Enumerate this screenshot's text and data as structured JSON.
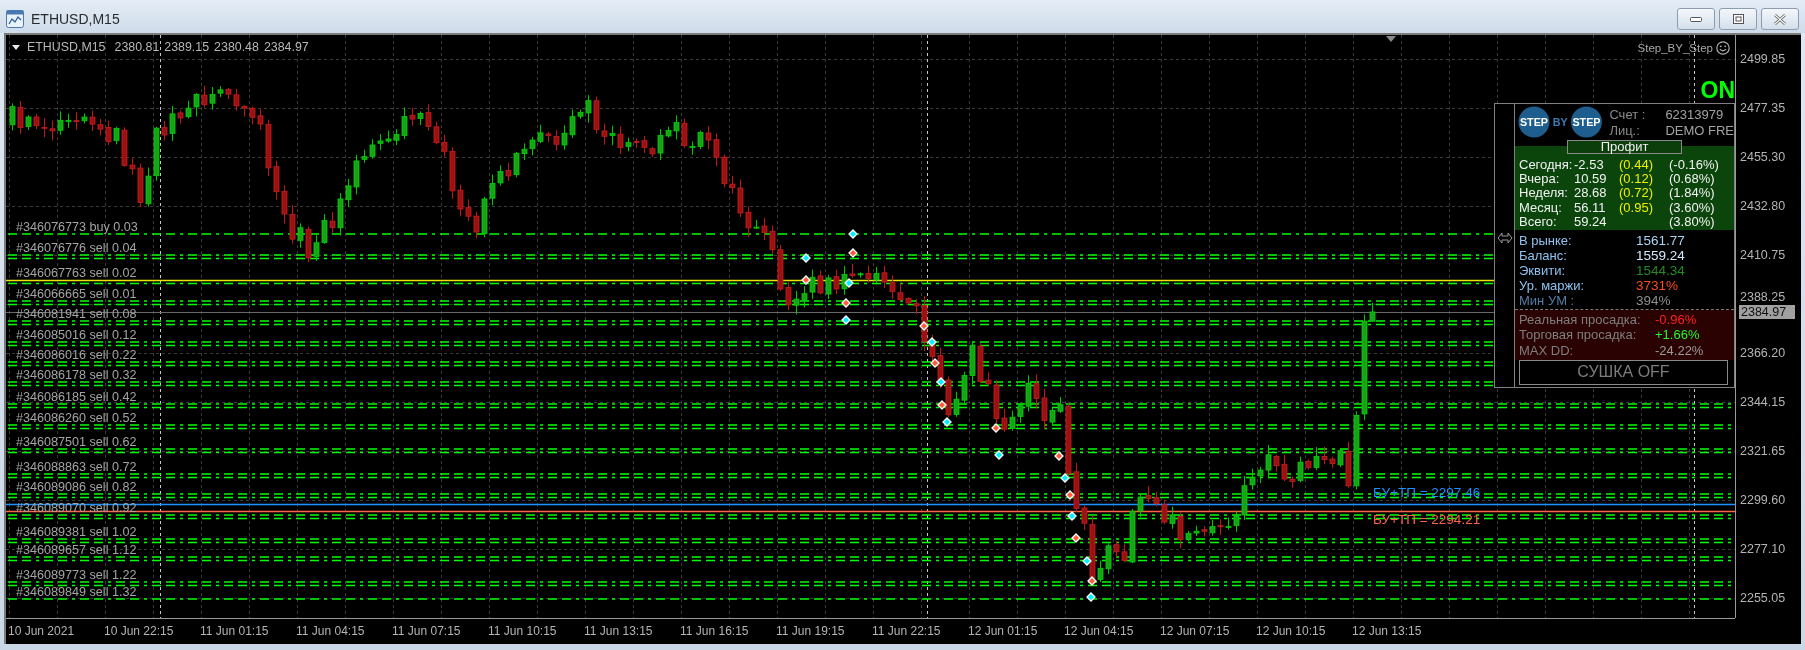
{
  "window": {
    "title": "ETHUSD,M15"
  },
  "chart_header": {
    "symbol": "ETHUSD,M15",
    "ohlc": [
      "2380.81",
      "2389.15",
      "2380.48",
      "2384.97"
    ]
  },
  "expert": {
    "name": "Step_BY_Step",
    "status": "ON"
  },
  "order_labels": [
    "#346076773 buy 0.03",
    "#346076776 sell 0.04",
    "#346067763 sell 0.02",
    "#346066665 sell 0.01",
    "#346081941 sell 0.08",
    "#346085016 sell 0.12",
    "#346086016 sell 0.22",
    "#346086178 sell 0.32",
    "#346086185 sell 0.42",
    "#346086260 sell 0.52",
    "#346087501 sell 0.62",
    "#346088863 sell 0.72",
    "#346089086 sell 0.82",
    "#346089070 sell 0.92",
    "#346089381 sell 1.02",
    "#346089657 sell 1.12",
    "#346089773 sell 1.22",
    "#346089849 sell 1.32"
  ],
  "breakeven_levels": [
    {
      "text": "БУ+ТП = 2297.46",
      "color": "#1e90ff"
    },
    {
      "text": "БУ+ТП = 2294.21",
      "color": "#ff6347"
    }
  ],
  "panel": {
    "logo": [
      "STEP",
      "BY",
      "STEP"
    ],
    "account": [
      {
        "label": "Счет :",
        "value": "62313979"
      },
      {
        "label": "Лиц.:",
        "value": "DEMO FRE"
      }
    ],
    "profit": {
      "title": "Профит",
      "rows": [
        {
          "label": "Сегодня:",
          "amount": "-2.53",
          "lots": "(0.44)",
          "percent": "(-0.16%)"
        },
        {
          "label": "Вчера:",
          "amount": "10.59",
          "lots": "(0.12)",
          "percent": "(0.68%)"
        },
        {
          "label": "Неделя:",
          "amount": "28.68",
          "lots": "(0.72)",
          "percent": "(1.84%)"
        },
        {
          "label": "Месяц:",
          "amount": "56.11",
          "lots": "(0.95)",
          "percent": "(3.60%)"
        },
        {
          "label": "Всего:",
          "amount": "59.24",
          "percent": "(3.80%)"
        }
      ]
    },
    "stats": [
      {
        "label": "В рынке:",
        "value": "1561.77",
        "color": "#a8d4f5",
        "muted": false
      },
      {
        "label": "Баланс:",
        "value": "1559.24",
        "color": "#d2e8ff",
        "muted": false
      },
      {
        "label": "Эквити:",
        "value": "1544.34",
        "color": "#228b22",
        "muted": false
      },
      {
        "label": "Ур. маржи:",
        "value": "3731%",
        "color": "#ff4a1c",
        "muted": false
      },
      {
        "label": "Мин УМ :",
        "value": "394%",
        "color": "#8e8e8e",
        "muted": true
      }
    ],
    "drawdowns": [
      {
        "label": "Реальная просадка:",
        "value": "-0.96%",
        "color": "#ff1e1e"
      },
      {
        "label": "Торговая просадка:",
        "value": "+1.66%",
        "color": "#1eff1e"
      },
      {
        "label": "MAX DD:",
        "value": "-24.22%",
        "color": "#9a9a9a"
      }
    ],
    "drying_button": "СУШКА OFF"
  },
  "price_axis": {
    "labels": [
      "2499.85",
      "2477.35",
      "2455.30",
      "2432.80",
      "2410.75",
      "2388.25",
      "2366.20",
      "2344.15",
      "2321.65",
      "2299.60",
      "2277.10",
      "2255.05"
    ],
    "current_price": "2384.97"
  },
  "time_axis": {
    "labels": [
      "10 Jun 2021",
      "10 Jun 22:15",
      "11 Jun 01:15",
      "11 Jun 04:15",
      "11 Jun 07:15",
      "11 Jun 10:15",
      "11 Jun 13:15",
      "11 Jun 16:15",
      "11 Jun 19:15",
      "11 Jun 22:15",
      "12 Jun 01:15",
      "12 Jun 04:15",
      "12 Jun 07:15",
      "12 Jun 10:15",
      "12 Jun 13:15"
    ]
  }
}
